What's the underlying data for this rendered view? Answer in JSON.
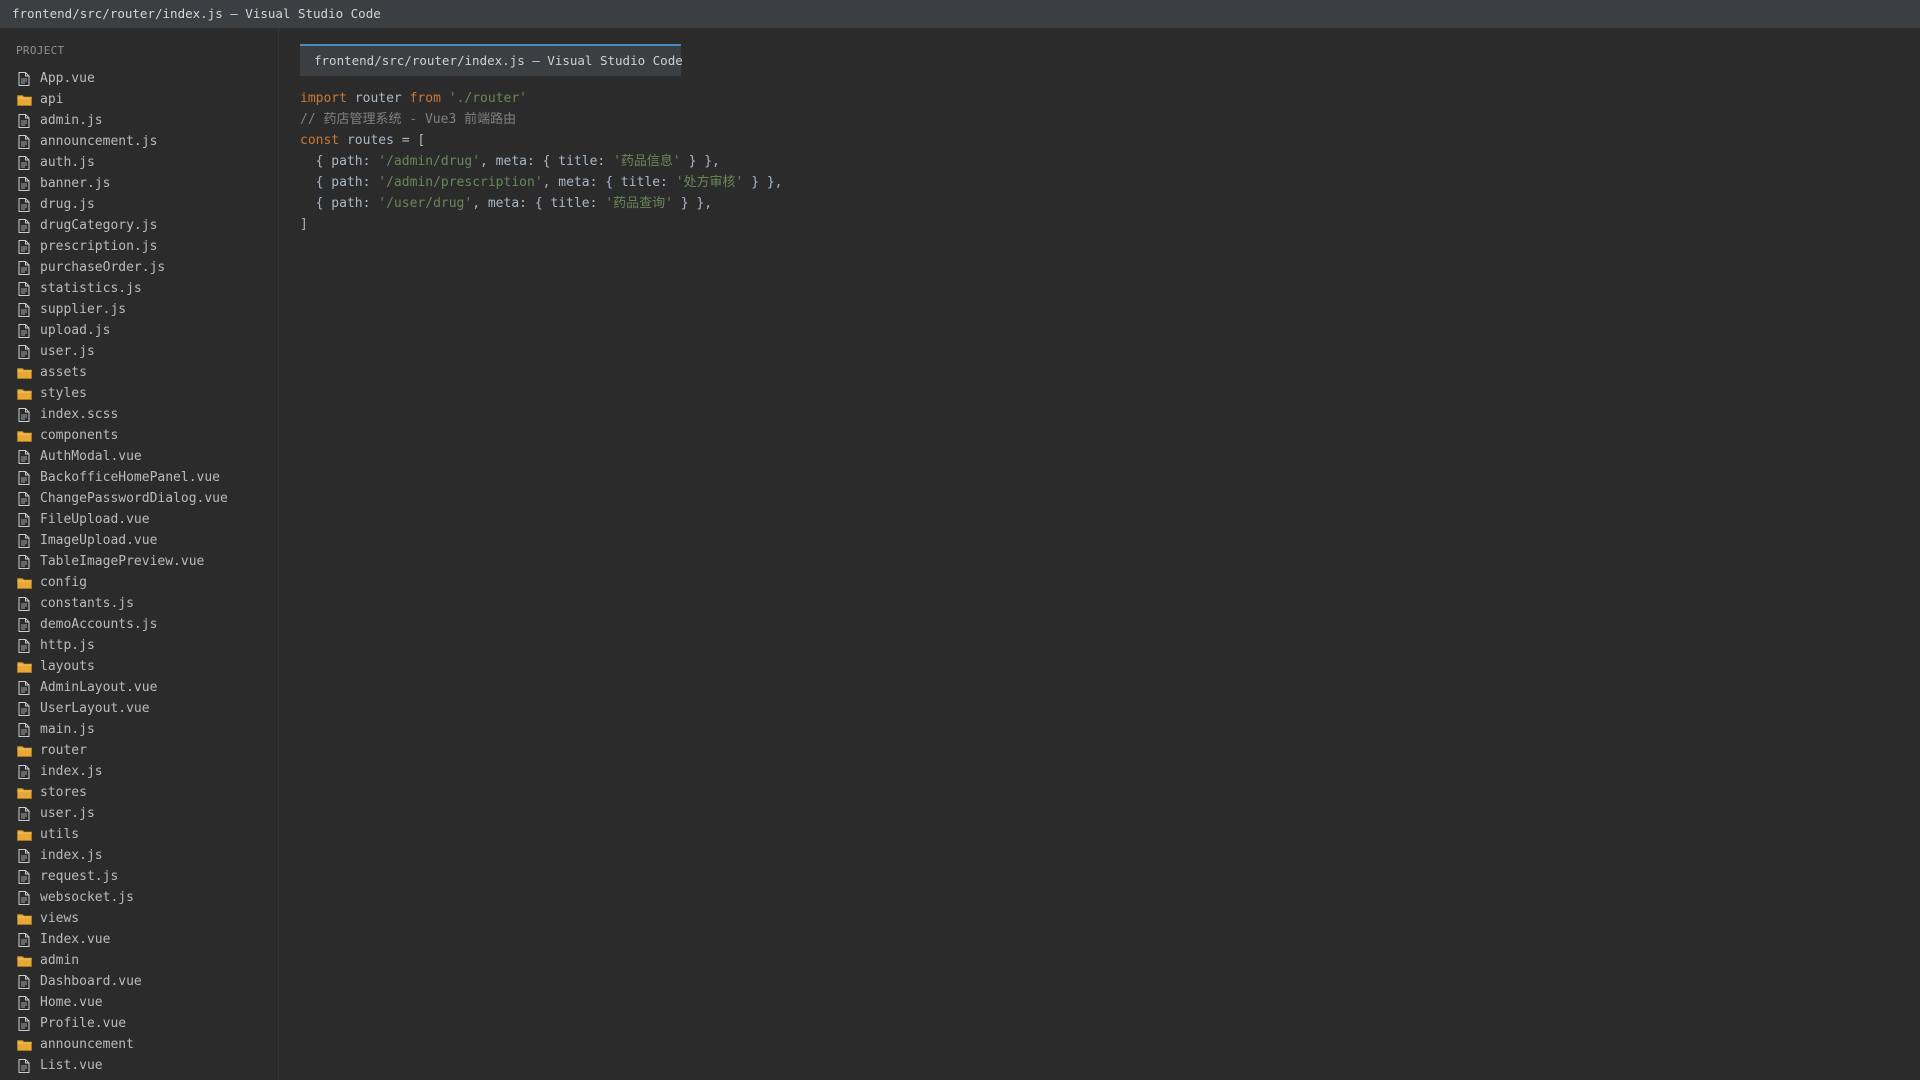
{
  "window": {
    "title": "frontend/src/router/index.js — Visual Studio Code"
  },
  "sidebar": {
    "heading": "PROJECT",
    "items": [
      {
        "label": "App.vue",
        "type": "file"
      },
      {
        "label": "api",
        "type": "folder"
      },
      {
        "label": "admin.js",
        "type": "file"
      },
      {
        "label": "announcement.js",
        "type": "file"
      },
      {
        "label": "auth.js",
        "type": "file"
      },
      {
        "label": "banner.js",
        "type": "file"
      },
      {
        "label": "drug.js",
        "type": "file"
      },
      {
        "label": "drugCategory.js",
        "type": "file"
      },
      {
        "label": "prescription.js",
        "type": "file"
      },
      {
        "label": "purchaseOrder.js",
        "type": "file"
      },
      {
        "label": "statistics.js",
        "type": "file"
      },
      {
        "label": "supplier.js",
        "type": "file"
      },
      {
        "label": "upload.js",
        "type": "file"
      },
      {
        "label": "user.js",
        "type": "file"
      },
      {
        "label": "assets",
        "type": "folder"
      },
      {
        "label": "styles",
        "type": "folder"
      },
      {
        "label": "index.scss",
        "type": "file"
      },
      {
        "label": "components",
        "type": "folder"
      },
      {
        "label": "AuthModal.vue",
        "type": "file"
      },
      {
        "label": "BackofficeHomePanel.vue",
        "type": "file"
      },
      {
        "label": "ChangePasswordDialog.vue",
        "type": "file"
      },
      {
        "label": "FileUpload.vue",
        "type": "file"
      },
      {
        "label": "ImageUpload.vue",
        "type": "file"
      },
      {
        "label": "TableImagePreview.vue",
        "type": "file"
      },
      {
        "label": "config",
        "type": "folder"
      },
      {
        "label": "constants.js",
        "type": "file"
      },
      {
        "label": "demoAccounts.js",
        "type": "file"
      },
      {
        "label": "http.js",
        "type": "file"
      },
      {
        "label": "layouts",
        "type": "folder"
      },
      {
        "label": "AdminLayout.vue",
        "type": "file"
      },
      {
        "label": "UserLayout.vue",
        "type": "file"
      },
      {
        "label": "main.js",
        "type": "file"
      },
      {
        "label": "router",
        "type": "folder"
      },
      {
        "label": "index.js",
        "type": "file"
      },
      {
        "label": "stores",
        "type": "folder"
      },
      {
        "label": "user.js",
        "type": "file"
      },
      {
        "label": "utils",
        "type": "folder"
      },
      {
        "label": "index.js",
        "type": "file"
      },
      {
        "label": "request.js",
        "type": "file"
      },
      {
        "label": "websocket.js",
        "type": "file"
      },
      {
        "label": "views",
        "type": "folder"
      },
      {
        "label": "Index.vue",
        "type": "file"
      },
      {
        "label": "admin",
        "type": "folder"
      },
      {
        "label": "Dashboard.vue",
        "type": "file"
      },
      {
        "label": "Home.vue",
        "type": "file"
      },
      {
        "label": "Profile.vue",
        "type": "file"
      },
      {
        "label": "announcement",
        "type": "folder"
      },
      {
        "label": "List.vue",
        "type": "file"
      }
    ]
  },
  "editor": {
    "tab_label": "frontend/src/router/index.js — Visual Studio Code",
    "code_lines": [
      [
        {
          "t": "import",
          "c": "kw"
        },
        {
          "t": " router ",
          "c": ""
        },
        {
          "t": "from",
          "c": "kw"
        },
        {
          "t": " ",
          "c": ""
        },
        {
          "t": "'./router'",
          "c": "str"
        }
      ],
      [
        {
          "t": "// 药店管理系统 - Vue3 前端路由",
          "c": "cm"
        }
      ],
      [
        {
          "t": "const",
          "c": "kw"
        },
        {
          "t": " routes = [",
          "c": ""
        }
      ],
      [
        {
          "t": "  { path: ",
          "c": ""
        },
        {
          "t": "'/admin/drug'",
          "c": "str"
        },
        {
          "t": ", meta: { title: ",
          "c": ""
        },
        {
          "t": "'药品信息'",
          "c": "str"
        },
        {
          "t": " } },",
          "c": ""
        }
      ],
      [
        {
          "t": "  { path: ",
          "c": ""
        },
        {
          "t": "'/admin/prescription'",
          "c": "str"
        },
        {
          "t": ", meta: { title: ",
          "c": ""
        },
        {
          "t": "'处方审核'",
          "c": "str"
        },
        {
          "t": " } },",
          "c": ""
        }
      ],
      [
        {
          "t": "  { path: ",
          "c": ""
        },
        {
          "t": "'/user/drug'",
          "c": "str"
        },
        {
          "t": ", meta: { title: ",
          "c": ""
        },
        {
          "t": "'药品查询'",
          "c": "str"
        },
        {
          "t": " } },",
          "c": ""
        }
      ],
      [
        {
          "t": "]",
          "c": ""
        }
      ]
    ]
  },
  "colors": {
    "keyword": "#cc7832",
    "string": "#6a8759",
    "comment": "#808080",
    "folder_icon": "#e8a838",
    "file_icon": "#c9ccd1",
    "tab_accent": "#4a88c7"
  },
  "icons": {
    "file": "file-icon",
    "folder": "folder-icon"
  }
}
